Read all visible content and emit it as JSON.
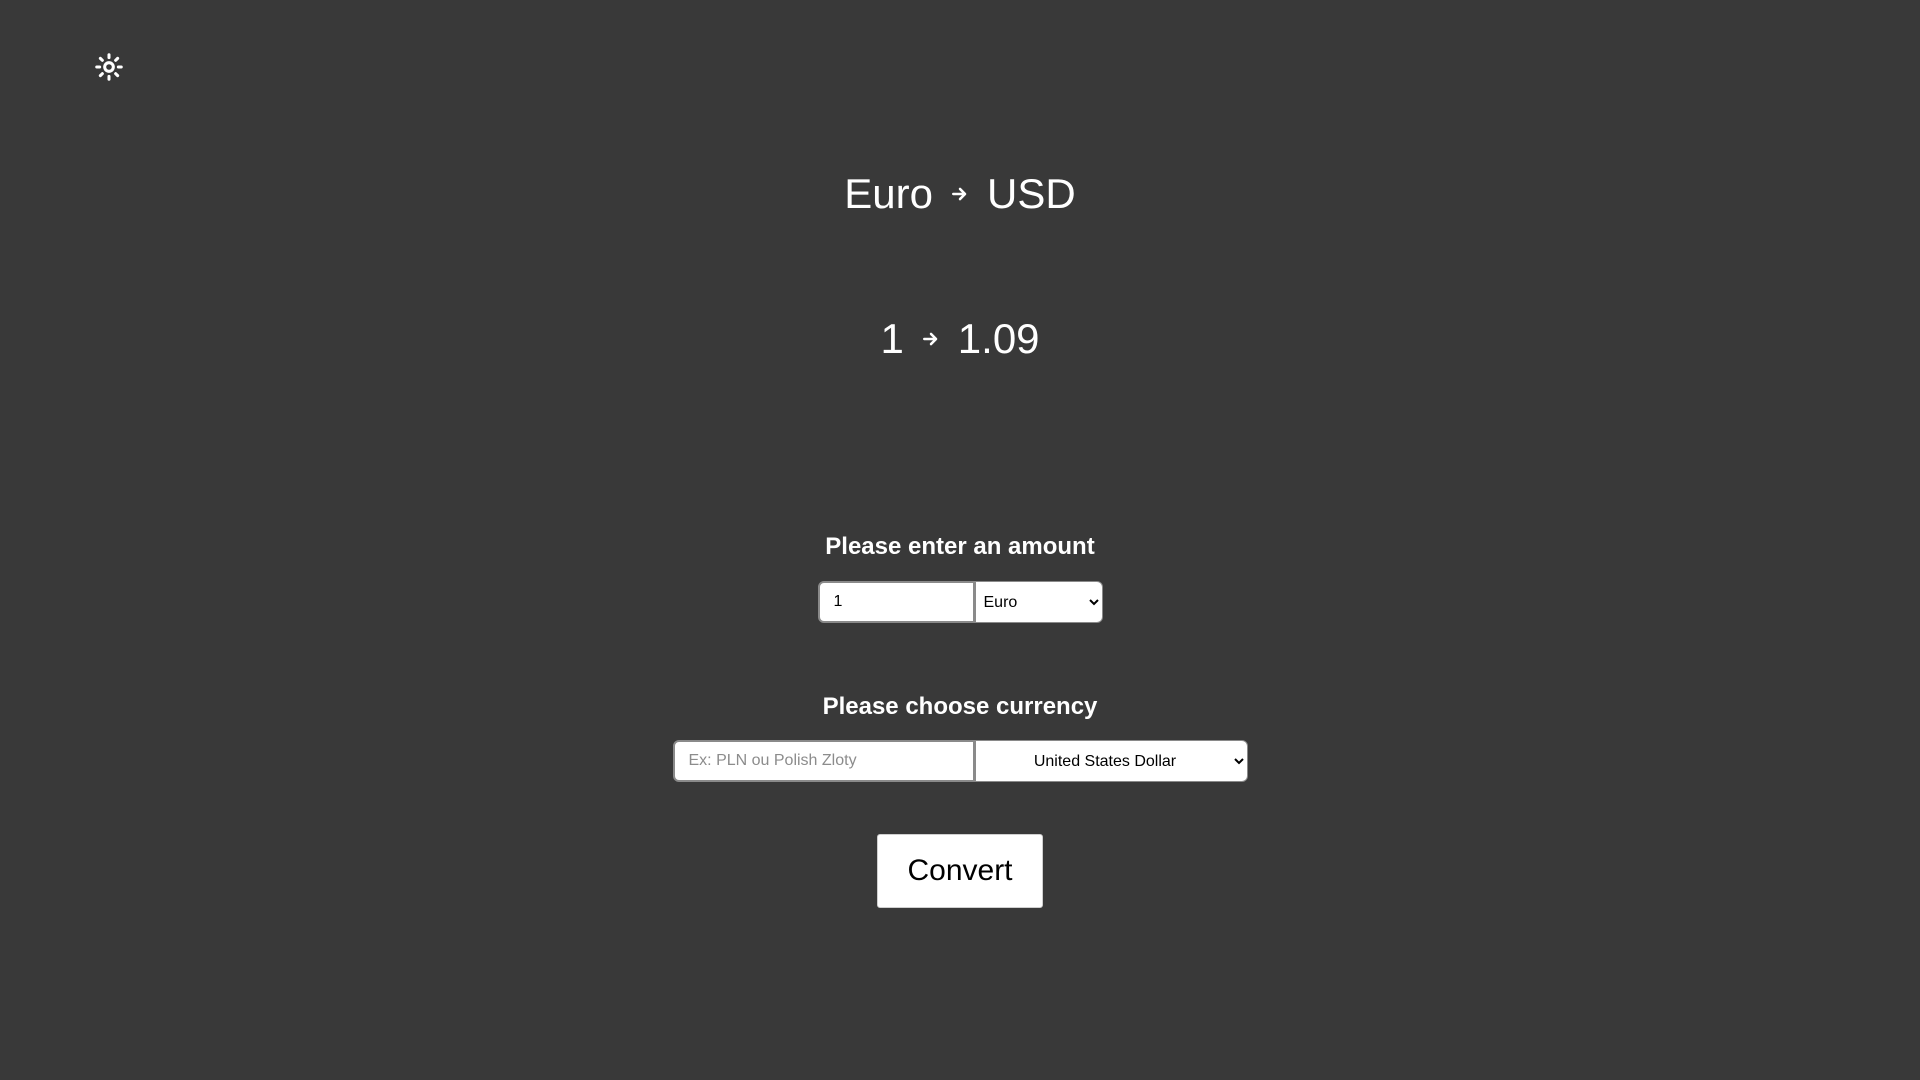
{
  "header": {
    "theme_icon": "sun-icon"
  },
  "pair": {
    "from": "Euro",
    "to": "USD",
    "arrow_icon": "arrow-right-icon"
  },
  "result": {
    "amount": "1",
    "converted": "1.09",
    "arrow_icon": "arrow-right-icon"
  },
  "amount_section": {
    "label": "Please enter an amount",
    "input_value": "1",
    "selected_currency": "Euro"
  },
  "currency_section": {
    "label": "Please choose currency",
    "search_placeholder": "Ex: PLN ou Polish Zloty",
    "selected_currency": "United States Dollar"
  },
  "actions": {
    "convert_label": "Convert"
  },
  "colors": {
    "background": "#393939",
    "text": "#ffffff",
    "button_bg": "#ffffff"
  }
}
